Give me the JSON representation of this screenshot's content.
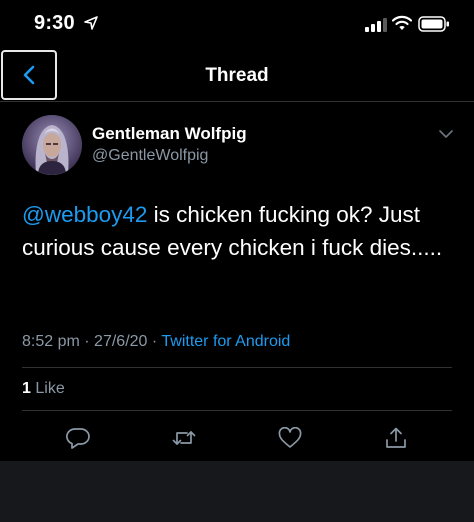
{
  "status_bar": {
    "time": "9:30"
  },
  "nav": {
    "title": "Thread"
  },
  "tweet": {
    "display_name": "Gentleman Wolfpig",
    "handle": "@GentleWolfpig",
    "mention": "@webboy42",
    "text_after_mention": " is chicken fucking ok? Just curious cause every chicken i fuck dies.....",
    "time": "8:52 pm",
    "date": "27/6/20",
    "separator": "·",
    "source": "Twitter for Android",
    "like_count": "1",
    "like_label": "Like"
  },
  "actions": [
    "reply-icon",
    "retweet-icon",
    "like-icon",
    "share-icon"
  ],
  "colors": {
    "background": "#000000",
    "accent": "#1d9bf0",
    "secondary_text": "#8b98a5",
    "divider": "#2f3336"
  }
}
